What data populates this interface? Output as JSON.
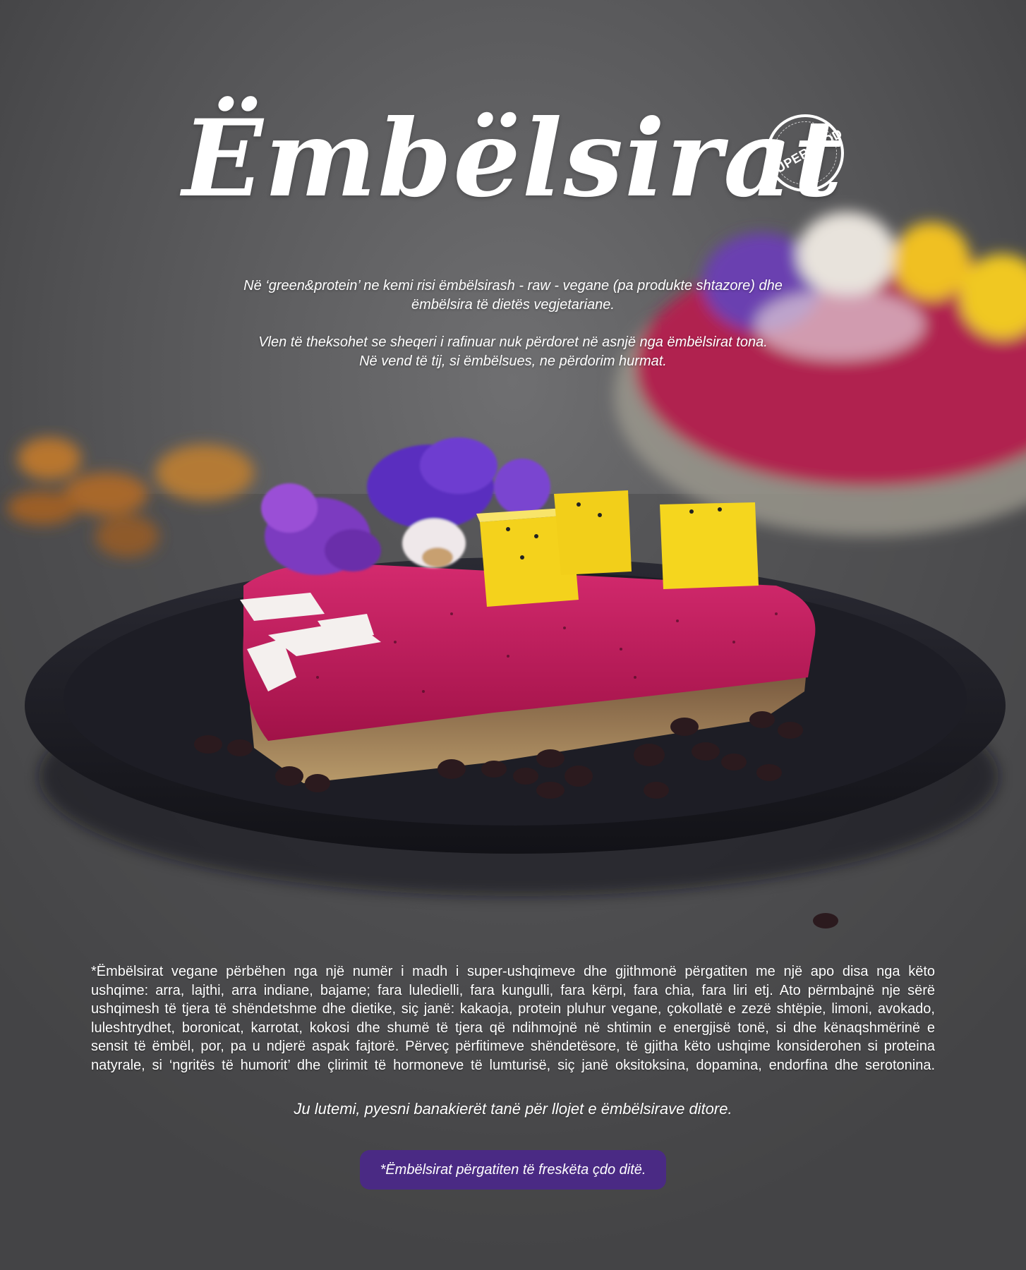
{
  "title": "Ëmbëlsirat",
  "badge": "SUPERFOOD",
  "intro": {
    "p1_line1": "Në ‘green&protein’ ne kemi risi ëmbëlsirash - raw - vegane (pa produkte shtazore) dhe",
    "p1_line2": "ëmbëlsira të dietës vegjetariane.",
    "p2_line1": "Vlen të theksohet se sheqeri i rafinuar nuk përdoret në asnjë nga ëmbëlsirat tona.",
    "p2_line2": "Në vend të tij, si ëmbëlsues, ne përdorim hurmat."
  },
  "body": {
    "line1": "*Ëmbëlsirat vegane përbëhen nga një numër i madh i super-ushqimeve dhe gjithmonë përgatiten me një apo disa nga këto",
    "line2": "ushqime: arra, lajthi, arra indiane, bajame; fara luledielli, fara kungulli, fara kërpi, fara chia, fara liri etj. Ato përmbajnë nje sërë",
    "line3": "ushqimesh të tjera të shëndetshme dhe dietike, siç janë: kakaoja, protein pluhur vegane, çokollatë e zezë shtëpie, limoni, avokado,",
    "line4": "luleshtrydhet, boronicat, karrotat, kokosi dhe shumë të tjera që ndihmojnë në shtimin e energjisë tonë, si dhe kënaqshmërinë e",
    "line5": "sensit të ëmbël, por, pa u ndjerë aspak fajtorë. Përveç përfitimeve shëndetësore, të gjitha këto ushqime konsiderohen si proteina",
    "line6": "natyrale, si ‘ngritës të humorit’ dhe çlirimit të hormoneve të lumturisë, siç janë oksitoksina, dopamina, endorfina dhe serotonina."
  },
  "note": "Ju lutemi, pyesni banakierët tanë për llojet e ëmbëlsirave ditore.",
  "pill": "*Ëmbëlsirat përgatiten të freskëta çdo ditë.",
  "colors": {
    "pill_background": "#4a2a84",
    "background": "#555557",
    "cake_pink": "#c21a5c",
    "mango_yellow": "#f5d31a",
    "flower_purple": "#7a3fc4",
    "plate": "#1b1b22"
  }
}
